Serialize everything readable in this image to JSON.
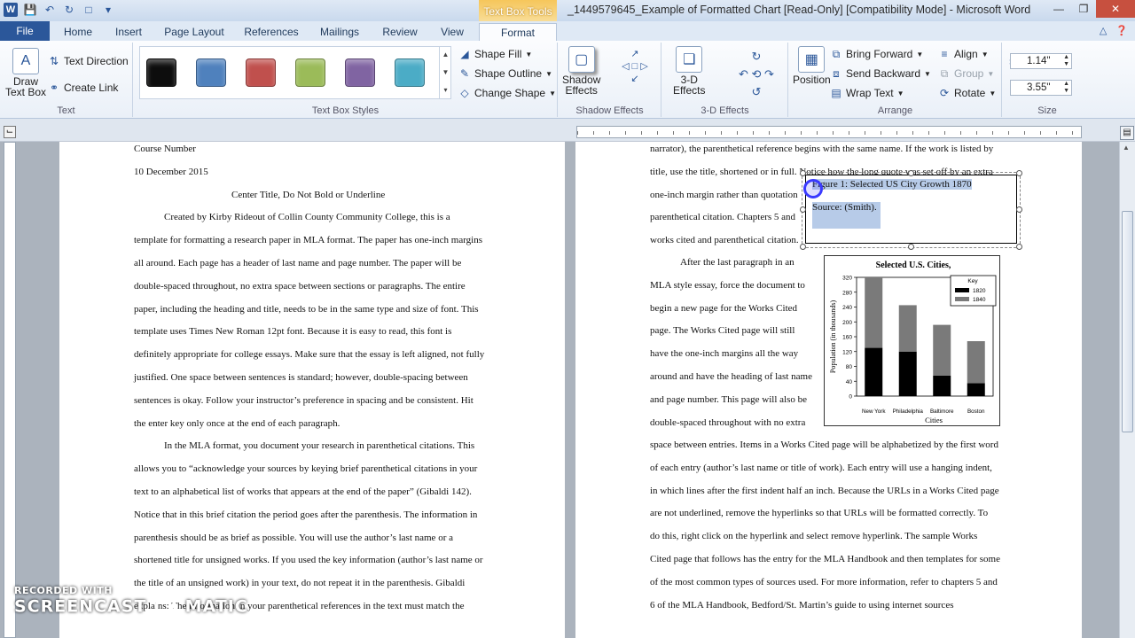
{
  "window": {
    "title": "_1449579645_Example of Formatted Chart [Read-Only] [Compatibility Mode]  -  Microsoft Word",
    "context_tab_header": "Text Box Tools"
  },
  "tabs": [
    "File",
    "Home",
    "Insert",
    "Page Layout",
    "References",
    "Mailings",
    "Review",
    "View",
    "Format"
  ],
  "ribbon": {
    "text_group": {
      "label": "Text",
      "draw_text_box_line1": "Draw",
      "draw_text_box_line2": "Text Box",
      "text_direction": "Text Direction",
      "create_link": "Create Link"
    },
    "styles_group": {
      "label": "Text Box Styles",
      "swatches": [
        "#0d0d0d",
        "#4f81bd",
        "#c0504d",
        "#9bbb59",
        "#8064a2",
        "#4bacc6"
      ],
      "shape_fill": "Shape Fill",
      "shape_outline": "Shape Outline",
      "change_shape": "Change Shape"
    },
    "shadow_group": {
      "label": "Shadow Effects",
      "btn_line1": "Shadow",
      "btn_line2": "Effects"
    },
    "threed_group": {
      "label": "3-D Effects",
      "btn_line1": "3-D",
      "btn_line2": "Effects"
    },
    "arrange_group": {
      "label": "Arrange",
      "position": "Position",
      "bring_forward": "Bring Forward",
      "send_backward": "Send Backward",
      "wrap_text": "Wrap Text",
      "align": "Align",
      "group": "Group",
      "rotate": "Rotate"
    },
    "size_group": {
      "label": "Size",
      "height": "1.14\"",
      "width": "3.55\""
    }
  },
  "page1_lines": [
    "Course Number",
    "10 December 2015",
    "Center Title, Do Not Bold or Underline",
    "Created by Kirby Rideout of Collin County Community College, this is a",
    "template for formatting a research paper in MLA format. The paper has one-inch margins",
    "all around. Each page has a header of last name and page number. The paper will be",
    "double-spaced throughout, no extra space between sections or paragraphs. The entire",
    "paper, including the heading and title, needs to be in the same type and size of font. This",
    "template uses Times New Roman 12pt font. Because it is easy to read, this font is",
    "definitely appropriate for college essays. Make sure that the essay is left aligned, not fully",
    "justified. One space between sentences is standard; however, double-spacing between",
    "sentences is okay. Follow your instructor’s preference in spacing and be consistent. Hit",
    "the enter key only once at the end of each paragraph.",
    "In the MLA format, you document your research in parenthetical citations. This",
    "allows you to “acknowledge your sources by keying brief parenthetical citations in your",
    "text to an alphabetical list of works that appears at the end of the paper” (Gibaldi 142).",
    "Notice that in this brief citation the period goes after the parenthesis. The information in",
    "parenthesis should be as brief as possible. You will use the author’s last name or a",
    "shortened title for unsigned works. If you used the key information (author’s last name or",
    "the title  of an unsigned work) in your text, do not repeat it in the parenthesis. Gibaldi",
    "explains: The information in your parenthetical references in the text must match the"
  ],
  "page2_lines_top": [
    "narrator), the parenthetical reference begins with the same name.  If the work is listed by",
    "title, use the title,  shortened or in full.  Notice how the long quote was set off by an extra",
    "one-inch margin rather than quotation",
    "parenthetical citation. Chapters 5 and",
    "works cited and parenthetical citation."
  ],
  "page2_lines_wrap": [
    "After the last paragraph in an",
    "MLA style essay, force the document to",
    "begin a new page for the Works Cited",
    "page.  The Works Cited page will still",
    "have the one-inch margins all the way",
    "around and have the heading of last name",
    "and page number. This page will also be",
    "double-spaced throughout with no extra"
  ],
  "page2_lines_bottom": [
    "space between entries. Items in a Works Cited page will be alphabetized by the first word",
    "of each entry (author’s last name or title of work). Each entry will use a hanging indent,",
    "in which lines after the first indent half an inch. Because the URLs  in a Works Cited page",
    "are not underlined, remove the hyperlinks so that URLs will be formatted correctly. To",
    "do this, right click on the hyperlink and select remove hyperlink. The sample Works",
    "Cited page that follows has the entry for the MLA Handbook and then templates for some",
    "of the most common types of sources used. For more information, refer to chapters 5 and",
    "6 of the MLA Handbook, Bedford/St. Martin’s guide to using internet sources"
  ],
  "textbox": {
    "caption": "Figure 1: Selected US City Growth 1870",
    "source": "Source: (Smith)."
  },
  "chart_data": {
    "type": "bar",
    "title": "Selected U.S. Cities,",
    "xlabel": "Cities",
    "ylabel": "Population  (in  thousands)",
    "ylim": [
      0,
      320
    ],
    "yticks": [
      0,
      40,
      80,
      120,
      160,
      200,
      240,
      280,
      320
    ],
    "categories": [
      "New  York",
      "Philadelphia",
      "Baltimore",
      "Boston"
    ],
    "stacked": true,
    "series": [
      {
        "name": "1820",
        "values": [
          130,
          120,
          55,
          35
        ],
        "color": "#000000"
      },
      {
        "name": "1840",
        "values": [
          190,
          125,
          137,
          113
        ],
        "color": "#7a7a7a"
      }
    ],
    "legend": {
      "title": "Key",
      "position": "top-right"
    }
  },
  "watermark": {
    "line1": "RECORDED WITH",
    "line2": "SCREENCAST",
    "line3": "MATIC"
  }
}
